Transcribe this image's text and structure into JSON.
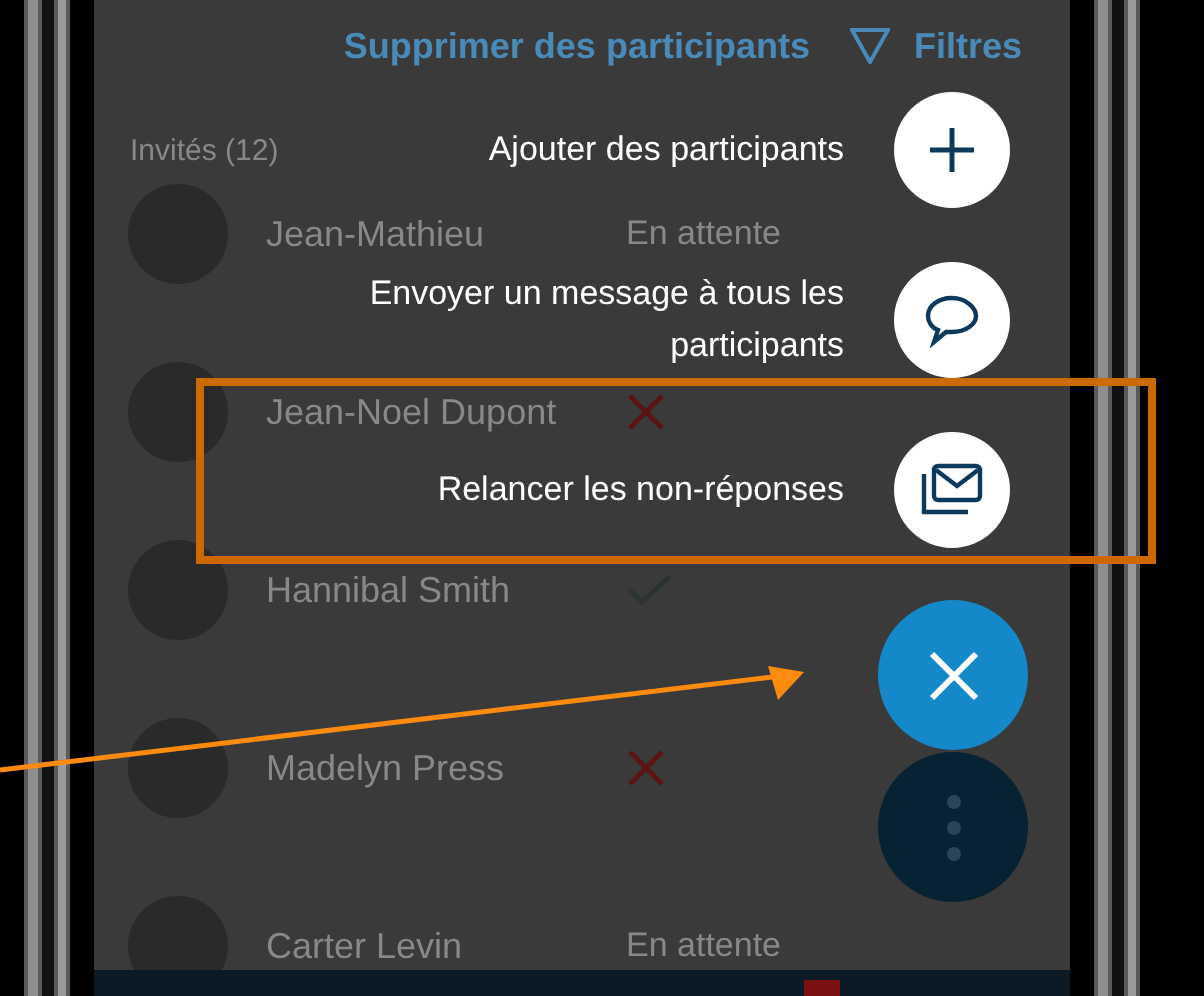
{
  "header": {
    "remove_label": "Supprimer des participants",
    "filter_label": "Filtres"
  },
  "list": {
    "title": "Invités (12)"
  },
  "rows": [
    {
      "name": "Jean-Mathieu",
      "status": {
        "kind": "pending",
        "text": "En attente"
      }
    },
    {
      "name": "Jean-Noel Dupont",
      "status": {
        "kind": "declined"
      }
    },
    {
      "name": "Hannibal Smith",
      "status": {
        "kind": "accepted"
      }
    },
    {
      "name": "Madelyn Press",
      "status": {
        "kind": "declined"
      }
    },
    {
      "name": "Carter Levin",
      "status": {
        "kind": "pending",
        "text": "En attente"
      }
    }
  ],
  "actions": [
    {
      "label": "Ajouter des participants",
      "kind": "add",
      "highlighted": false
    },
    {
      "label": "Envoyer un message à tous les participants",
      "kind": "message",
      "highlighted": false
    },
    {
      "label": "Relancer les non-réponses",
      "kind": "remind",
      "highlighted": true
    }
  ]
}
